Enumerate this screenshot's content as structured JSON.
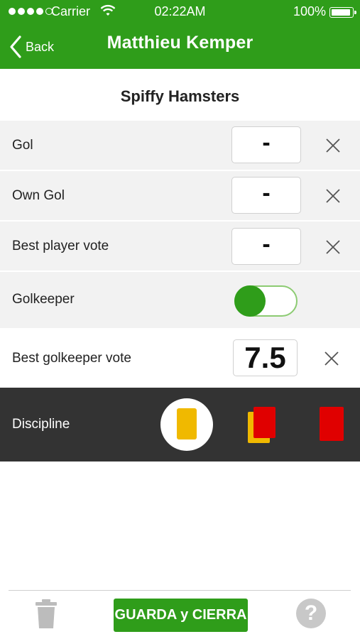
{
  "status_bar": {
    "carrier": "Carrier",
    "time": "02:22AM",
    "battery": "100%"
  },
  "nav": {
    "back_label": "Back",
    "title": "Matthieu Kemper"
  },
  "team": "Spiffy Hamsters",
  "stats": [
    {
      "label": "Gol",
      "value": "-"
    },
    {
      "label": "Own Gol",
      "value": "-"
    },
    {
      "label": "Best player vote",
      "value": "-"
    }
  ],
  "goalkeeper": {
    "label": "Golkeeper",
    "enabled": true
  },
  "goalkeeper_vote": {
    "label": "Best golkeeper vote",
    "value": "7.5"
  },
  "discipline": {
    "label": "Discipline",
    "options": [
      "yellow-card",
      "double-yellow-red-card",
      "red-card"
    ],
    "selected": "yellow-card"
  },
  "toolbar": {
    "save_label": "GUARDA y CIERRA"
  },
  "colors": {
    "brand_green": "#2f9d1a",
    "discipline_bg": "#333333",
    "yellow": "#f0b900",
    "red": "#e00000"
  }
}
